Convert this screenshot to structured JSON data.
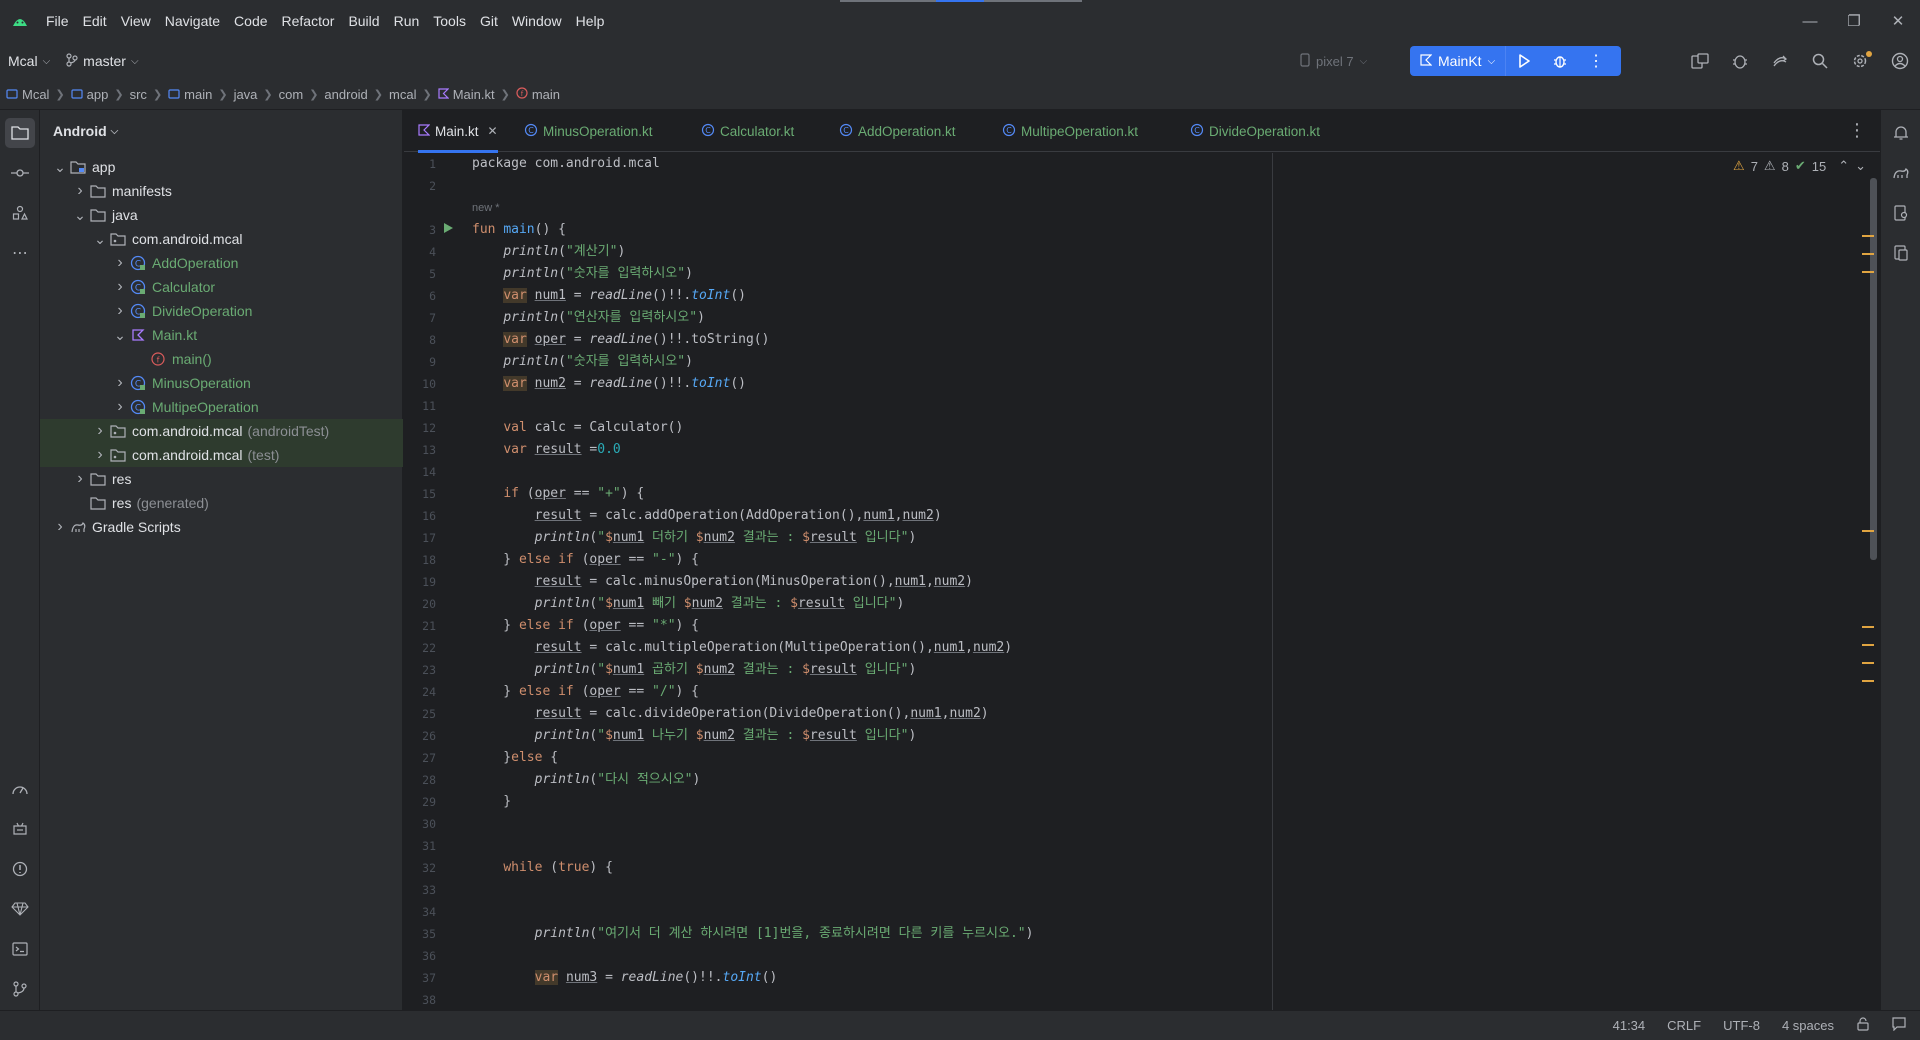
{
  "menu": [
    "File",
    "Edit",
    "View",
    "Navigate",
    "Code",
    "Refactor",
    "Build",
    "Run",
    "Tools",
    "Git",
    "Window",
    "Help"
  ],
  "toolbar": {
    "project": "Mcal",
    "branch": "master",
    "device": "pixel 7",
    "run_config": "MainKt"
  },
  "breadcrumb": [
    "Mcal",
    "app",
    "src",
    "main",
    "java",
    "com",
    "android",
    "mcal",
    "Main.kt",
    "main"
  ],
  "project_panel": {
    "title": "Android",
    "tree": [
      {
        "label": "app",
        "suffix": "",
        "green": false
      },
      {
        "label": "manifests",
        "suffix": "",
        "green": false
      },
      {
        "label": "java",
        "suffix": "",
        "green": false
      },
      {
        "label": "com.android.mcal",
        "suffix": "",
        "green": false
      },
      {
        "label": "AddOperation",
        "suffix": "",
        "green": true
      },
      {
        "label": "Calculator",
        "suffix": "",
        "green": true
      },
      {
        "label": "DivideOperation",
        "suffix": "",
        "green": true
      },
      {
        "label": "Main.kt",
        "suffix": "",
        "green": true
      },
      {
        "label": "main()",
        "suffix": "",
        "green": true
      },
      {
        "label": "MinusOperation",
        "suffix": "",
        "green": true
      },
      {
        "label": "MultipeOperation",
        "suffix": "",
        "green": true
      },
      {
        "label": "com.android.mcal",
        "suffix": "(androidTest)",
        "green": false
      },
      {
        "label": "com.android.mcal",
        "suffix": "(test)",
        "green": false
      },
      {
        "label": "res",
        "suffix": "",
        "green": false
      },
      {
        "label": "res",
        "suffix": "(generated)",
        "green": false
      },
      {
        "label": "Gradle Scripts",
        "suffix": "",
        "green": false
      }
    ]
  },
  "tabs": [
    "Main.kt",
    "MinusOperation.kt",
    "Calculator.kt",
    "AddOperation.kt",
    "MultipeOperation.kt",
    "DivideOperation.kt"
  ],
  "inspections": {
    "warnings": "7",
    "weak_warnings": "8",
    "ok": "15"
  },
  "code_hint": "new *",
  "line_numbers": [
    "1",
    "2",
    "3",
    "4",
    "5",
    "6",
    "7",
    "8",
    "9",
    "10",
    "11",
    "12",
    "13",
    "14",
    "15",
    "16",
    "17",
    "18",
    "19",
    "20",
    "21",
    "22",
    "23",
    "24",
    "25",
    "26",
    "27",
    "28",
    "29",
    "30",
    "31",
    "32",
    "33",
    "34",
    "35",
    "36",
    "37",
    "38"
  ],
  "code": {
    "l1": "package com.android.mcal",
    "s4": "\"계산기\"",
    "s5": "\"숫자를 입력하시오\"",
    "s7": "\"연산자를 입력하시오\"",
    "s9": "\"숫자를 입력하시오\"",
    "s17": " 더하기 ",
    "s17b": " 결과는 : ",
    "s17c": " 입니다\"",
    "s20": " 빼기 ",
    "s23": " 곱하기 ",
    "s26": " 나누기 ",
    "s28": "\"다시 적으시오\"",
    "s35": "\"여기서 더 계산 하시려면 [1]번을, 종료하시려면 다른 키를 누르시오.\""
  },
  "status": {
    "position": "41:34",
    "line_sep": "CRLF",
    "encoding": "UTF-8",
    "indent": "4 spaces"
  }
}
